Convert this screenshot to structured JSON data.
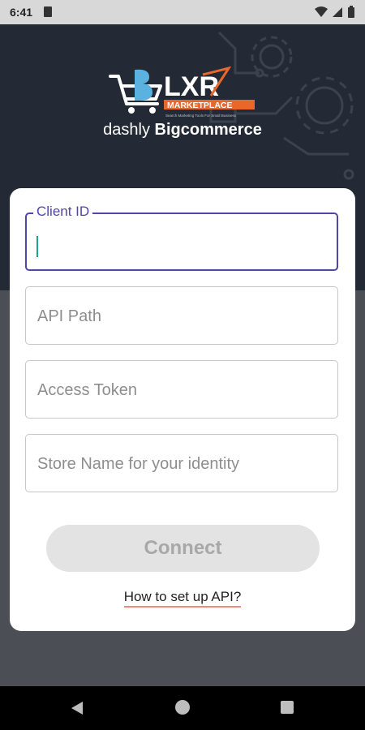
{
  "status": {
    "time": "6:41"
  },
  "brand": {
    "logo_text": "LXR",
    "logo_sub": "MARKETPLACE",
    "logo_tagline": "Search Marketing Tools For Small Business",
    "prefix": "dashly",
    "name": "Bigcommerce",
    "accent_color": "#e8682c"
  },
  "form": {
    "client_id": {
      "label": "Client ID",
      "value": ""
    },
    "api_path": {
      "placeholder": "API Path"
    },
    "access_token": {
      "placeholder": "Access Token"
    },
    "store_name": {
      "placeholder": "Store Name for your identity"
    },
    "connect_label": "Connect",
    "help_link": "How to set up API?"
  },
  "colors": {
    "header_bg": "#232a35",
    "focus": "#4f46a8",
    "link_underline": "#ef8a7a"
  }
}
